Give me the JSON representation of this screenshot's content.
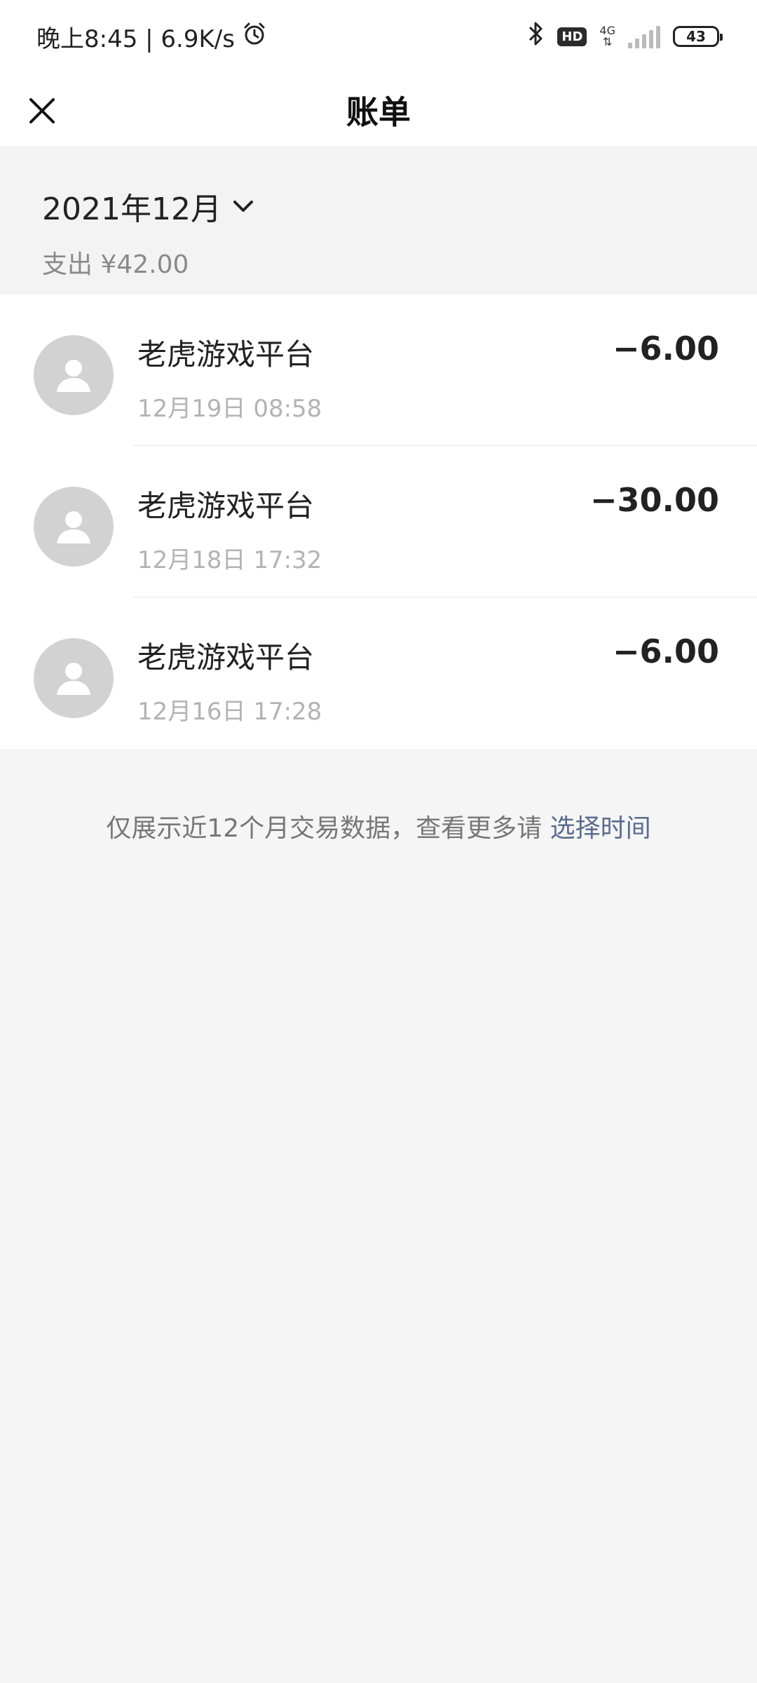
{
  "status_bar": {
    "time": "晚上8:45 | 6.9K/s",
    "hd": "HD",
    "network": "4G",
    "battery": "43"
  },
  "header": {
    "title": "账单"
  },
  "summary": {
    "month": "2021年12月",
    "expense": "支出 ¥42.00"
  },
  "transactions": [
    {
      "name": "老虎游戏平台",
      "time": "12月19日 08:58",
      "amount": "−6.00"
    },
    {
      "name": "老虎游戏平台",
      "time": "12月18日 17:32",
      "amount": "−30.00"
    },
    {
      "name": "老虎游戏平台",
      "time": "12月16日 17:28",
      "amount": "−6.00"
    }
  ],
  "footer": {
    "note": "仅展示近12个月交易数据，查看更多请 ",
    "link": "选择时间"
  },
  "colors": {
    "link": "#5a6c8e",
    "background": "#f5f5f5",
    "avatar": "#d2d2d2"
  }
}
